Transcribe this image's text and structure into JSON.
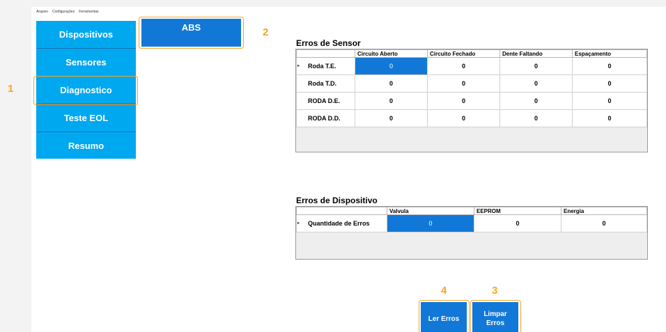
{
  "menubar": [
    "Arquivo",
    "Configurações",
    "Ferramentas"
  ],
  "nav": {
    "items": [
      "Dispositivos",
      "Sensores",
      "Diagnostico",
      "Teste EOL",
      "Resumo"
    ]
  },
  "submenu": {
    "abs_label": "ABS"
  },
  "callouts": {
    "n1": "1",
    "n2": "2",
    "n3": "3",
    "n4": "4"
  },
  "sensor_errors": {
    "title": "Erros de Sensor",
    "columns": [
      "Circuito Aberto",
      "Circuito Fechado",
      "Dente Faltando",
      "Espaçamento"
    ],
    "rows": [
      {
        "label": "Roda T.E.",
        "values": [
          "0",
          "0",
          "0",
          "0"
        ]
      },
      {
        "label": "Roda T.D.",
        "values": [
          "0",
          "0",
          "0",
          "0"
        ]
      },
      {
        "label": "RODA D.E.",
        "values": [
          "0",
          "0",
          "0",
          "0"
        ]
      },
      {
        "label": "RODA D.D.",
        "values": [
          "0",
          "0",
          "0",
          "0"
        ]
      }
    ]
  },
  "device_errors": {
    "title": "Erros de Dispositivo",
    "columns": [
      "Valvula",
      "EEPROM",
      "Energia"
    ],
    "rows": [
      {
        "label": "Quantidade de Erros",
        "values": [
          "0",
          "0",
          "0"
        ]
      }
    ]
  },
  "actions": {
    "read_label": "Ler Erros",
    "clear_label_1": "Limpar",
    "clear_label_2": "Erros"
  },
  "colors": {
    "nav_bg": "#00a8f0",
    "selected_bg": "#1278d8",
    "callout": "#f5a623"
  }
}
